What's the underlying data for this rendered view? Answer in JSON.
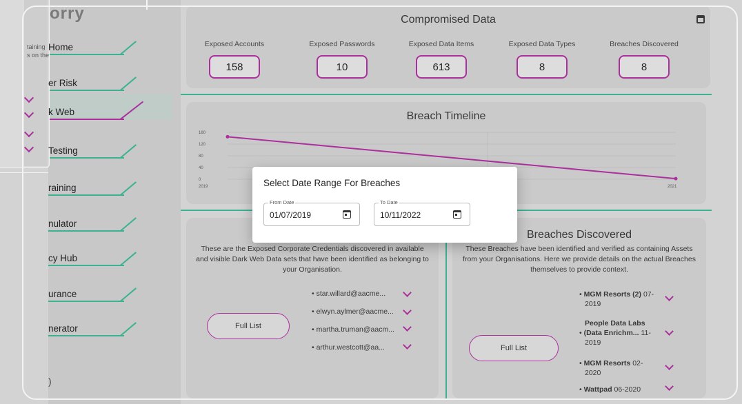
{
  "sidebar": {
    "brand": "orry",
    "items": [
      {
        "label": "Home"
      },
      {
        "label": "er Risk"
      },
      {
        "label": "k Web"
      },
      {
        "label": "Testing"
      },
      {
        "label": "raining"
      },
      {
        "label": "nulator"
      },
      {
        "label": "cy Hub"
      },
      {
        "label": "urance"
      },
      {
        "label": "nerator"
      }
    ],
    "bottom_label": ")"
  },
  "side_popover": {
    "line1": "taining",
    "line2": "s on the"
  },
  "compromised": {
    "title": "Compromised Data",
    "stats": [
      {
        "label": "Exposed Accounts",
        "value": "158"
      },
      {
        "label": "Exposed Passwords",
        "value": "10"
      },
      {
        "label": "Exposed Data Items",
        "value": "613"
      },
      {
        "label": "Exposed Data Types",
        "value": "8"
      },
      {
        "label": "Breaches Discovered",
        "value": "8"
      }
    ]
  },
  "timeline": {
    "title": "Breach Timeline"
  },
  "chart_data": {
    "type": "line",
    "title": "Breach Timeline",
    "x": [
      "2019",
      "2021"
    ],
    "yticks": [
      0,
      40,
      80,
      120,
      160
    ],
    "ylim": [
      0,
      160
    ],
    "series": [
      {
        "values": [
          145,
          2
        ]
      }
    ],
    "grid": true
  },
  "creds": {
    "description": "These are the Exposed Corporate Credentials discovered in available and visible Dark Web Data sets that have been identified as belonging to your Organisation.",
    "full_list": "Full List",
    "emails": [
      "star.willard@aacme...",
      "elwyn.aylmer@aacme...",
      "martha.truman@aacm...",
      "arthur.westcott@aa..."
    ]
  },
  "breaches": {
    "title": "Breaches Discovered",
    "description": "These Breaches have been identified and verified as containing Assets from your Organisations. Here we provide details on the actual Breaches themselves to provide context.",
    "full_list": "Full List",
    "items": [
      {
        "name": "MGM Resorts (2)",
        "date_a": "07-",
        "date_b": "2019"
      },
      {
        "name": "People Data Labs",
        "name2": "(Data Enrichm...",
        "date_a": "11-",
        "date_b": "2019"
      },
      {
        "name": "MGM Resorts",
        "date_a": "02-",
        "date_b": "2020"
      },
      {
        "name": "Wattpad",
        "date_a": "06-2020",
        "date_b": ""
      }
    ]
  },
  "dialog": {
    "title": "Select Date Range For Breaches",
    "from_label": "From Date",
    "from_value": "01/07/2019",
    "to_label": "To Date",
    "to_value": "10/11/2022"
  },
  "colors": {
    "accent": "#b02aa0",
    "green": "#38b894"
  }
}
